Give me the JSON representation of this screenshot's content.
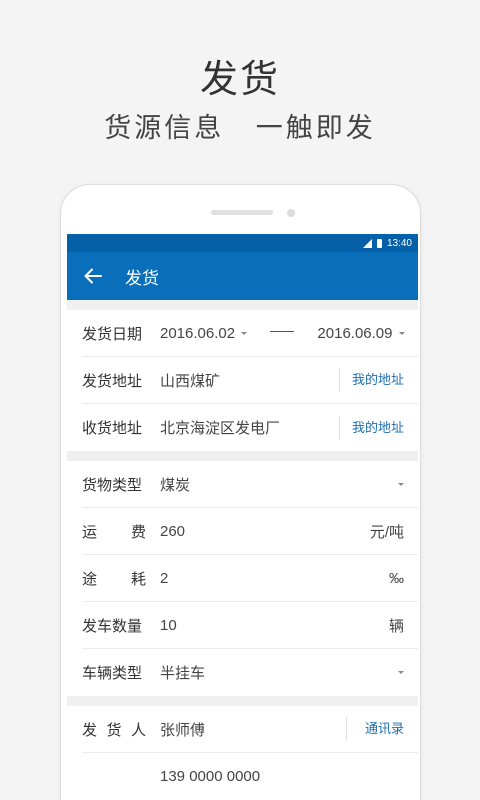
{
  "promo": {
    "title": "发货",
    "subtitle": "货源信息   一触即发"
  },
  "status_bar": {
    "time": "13:40"
  },
  "app_bar": {
    "title": "发货"
  },
  "shipping": {
    "date": {
      "label": "发货日期",
      "start": "2016.06.02",
      "end": "2016.06.09"
    },
    "origin": {
      "label": "发货地址",
      "value": "山西煤矿",
      "action": "我的地址"
    },
    "destination": {
      "label": "收货地址",
      "value": "北京海淀区发电厂",
      "action": "我的地址"
    }
  },
  "cargo": {
    "type": {
      "label": "货物类型",
      "value": "煤炭"
    },
    "freight": {
      "label_1": "运",
      "label_2": "费",
      "value": "260",
      "unit": "元/吨"
    },
    "loss": {
      "label_1": "途",
      "label_2": "耗",
      "value": "2",
      "unit": "‰"
    },
    "count": {
      "label": "发车数量",
      "value": "10",
      "unit": "辆"
    },
    "vehicle": {
      "label": "车辆类型",
      "value": "半挂车"
    }
  },
  "contact": {
    "sender": {
      "label_1": "发",
      "label_2": "货",
      "label_3": "人",
      "value": "张师傅",
      "action": "通讯录"
    },
    "phone": {
      "value": "139 0000 0000"
    }
  },
  "colors": {
    "primary": "#0a6fba",
    "status_bar": "#0660a8",
    "link": "#1e6fb3"
  },
  "icons": {
    "back": "arrow-left-icon",
    "signal": "signal-icon",
    "battery": "battery-icon",
    "dropdown": "caret-down-icon"
  }
}
